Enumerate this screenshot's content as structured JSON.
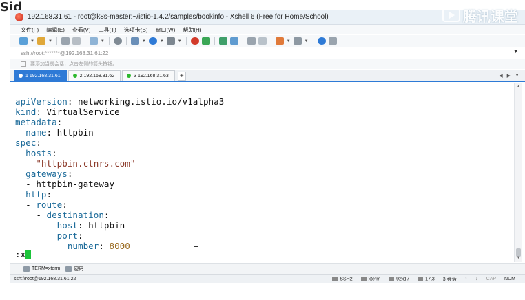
{
  "window": {
    "title": "192.168.31.61 - root@k8s-master:~/istio-1.4.2/samples/bookinfo - Xshell 6 (Free for Home/School)",
    "watermark": "腾讯课堂"
  },
  "menu": [
    "文件(F)",
    "编辑(E)",
    "查看(V)",
    "工具(T)",
    "选项卡(B)",
    "窗口(W)",
    "帮助(H)"
  ],
  "address": "ssh://root:*******@192.168.31.61:22",
  "hint": "要添加当前会话，点击左侧的箭头按钮。",
  "tabs": [
    {
      "label": "1 192.168.31.61",
      "active": true
    },
    {
      "label": "2 192.168.31.62",
      "active": false
    },
    {
      "label": "3 192.168.31.63",
      "active": false
    }
  ],
  "terminal": {
    "lines": [
      [
        {
          "t": "---",
          "c": "v"
        }
      ],
      [
        {
          "t": "apiVersion",
          "c": "k"
        },
        {
          "t": ": networking.istio.io/v1alpha3",
          "c": "v"
        }
      ],
      [
        {
          "t": "kind",
          "c": "k"
        },
        {
          "t": ": VirtualService",
          "c": "v"
        }
      ],
      [
        {
          "t": "metadata",
          "c": "k"
        },
        {
          "t": ":",
          "c": "v"
        }
      ],
      [
        {
          "t": "  ",
          "c": "v"
        },
        {
          "t": "name",
          "c": "k"
        },
        {
          "t": ": httpbin",
          "c": "v"
        }
      ],
      [
        {
          "t": "spec",
          "c": "k"
        },
        {
          "t": ":",
          "c": "v"
        }
      ],
      [
        {
          "t": "  ",
          "c": "v"
        },
        {
          "t": "hosts",
          "c": "k"
        },
        {
          "t": ":",
          "c": "v"
        }
      ],
      [
        {
          "t": "  - ",
          "c": "v"
        },
        {
          "t": "\"httpbin.ctnrs.com\"",
          "c": "s"
        }
      ],
      [
        {
          "t": "  ",
          "c": "v"
        },
        {
          "t": "gateways",
          "c": "k"
        },
        {
          "t": ":",
          "c": "v"
        }
      ],
      [
        {
          "t": "  - httpbin-gateway",
          "c": "v"
        }
      ],
      [
        {
          "t": "  ",
          "c": "v"
        },
        {
          "t": "http",
          "c": "k"
        },
        {
          "t": ":",
          "c": "v"
        }
      ],
      [
        {
          "t": "  - ",
          "c": "v"
        },
        {
          "t": "route",
          "c": "k"
        },
        {
          "t": ":",
          "c": "v"
        }
      ],
      [
        {
          "t": "    - ",
          "c": "v"
        },
        {
          "t": "destination",
          "c": "k"
        },
        {
          "t": ":",
          "c": "v"
        }
      ],
      [
        {
          "t": "        ",
          "c": "v"
        },
        {
          "t": "host",
          "c": "k"
        },
        {
          "t": ": httpbin",
          "c": "v"
        }
      ],
      [
        {
          "t": "        ",
          "c": "v"
        },
        {
          "t": "port",
          "c": "k"
        },
        {
          "t": ":",
          "c": "v"
        }
      ],
      [
        {
          "t": "          ",
          "c": "v"
        },
        {
          "t": "number",
          "c": "k"
        },
        {
          "t": ": ",
          "c": "v"
        },
        {
          "t": "8000",
          "c": "n"
        }
      ]
    ],
    "command": ":x"
  },
  "compose": {
    "term_label": "TERM=xterm",
    "lock_label": "密码"
  },
  "status": {
    "connection": "ssh://root@192.168.31.61:22",
    "protocol": "SSH2",
    "term": "xterm",
    "size": "92x17",
    "position": "17,3",
    "sessions": "3 会话",
    "cap": "CAP",
    "num": "NUM"
  }
}
